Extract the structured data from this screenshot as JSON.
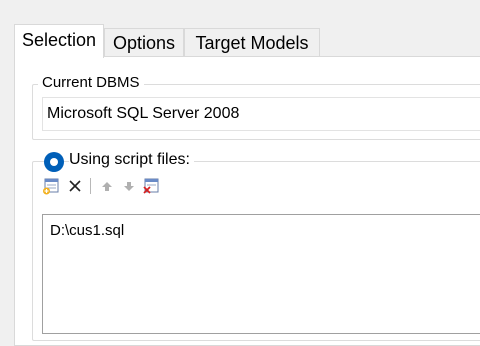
{
  "tabs": [
    {
      "label": "Selection",
      "active": true
    },
    {
      "label": "Options",
      "active": false
    },
    {
      "label": "Target Models",
      "active": false
    }
  ],
  "current_dbms": {
    "legend": "Current DBMS",
    "value": "Microsoft SQL Server 2008"
  },
  "script_files": {
    "option_label": "Using script files:",
    "selected": true,
    "toolbar": [
      "add-file-icon",
      "delete-icon",
      "move-up-icon",
      "move-down-icon",
      "clear-list-icon"
    ],
    "files": [
      "D:\\cus1.sql"
    ]
  },
  "colors": {
    "accent": "#005fb8",
    "window_bg": "#f0f0f0",
    "panel_bg": "#ffffff"
  }
}
